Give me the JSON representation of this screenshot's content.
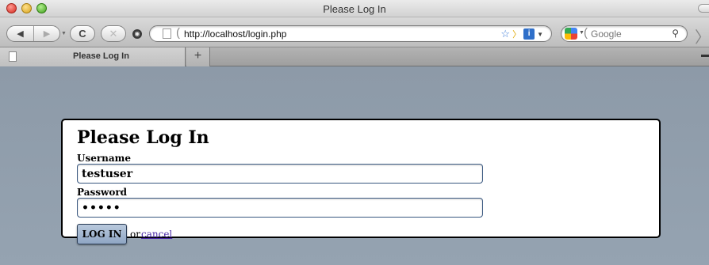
{
  "window": {
    "title": "Please Log In"
  },
  "toolbar": {
    "back_glyph": "◀",
    "forward_glyph": "▶",
    "reload_glyph": "C",
    "stop_glyph": "✕",
    "url": "http://localhost/login.php",
    "search_placeholder": "Google"
  },
  "tabs": [
    {
      "label": "Please Log In"
    }
  ],
  "new_tab_glyph": "+",
  "form": {
    "heading": "Please Log In",
    "username_label": "Username",
    "username_value": "testuser",
    "password_label": "Password",
    "password_value": "•••••",
    "login_button": "LOG IN",
    "or_text": "or",
    "cancel_link": "cancel"
  },
  "colors": {
    "page_background": "#8c9aa8",
    "button_fill": "#a3b6cf",
    "field_border": "#3c5a82",
    "link": "#4b2aa8"
  }
}
